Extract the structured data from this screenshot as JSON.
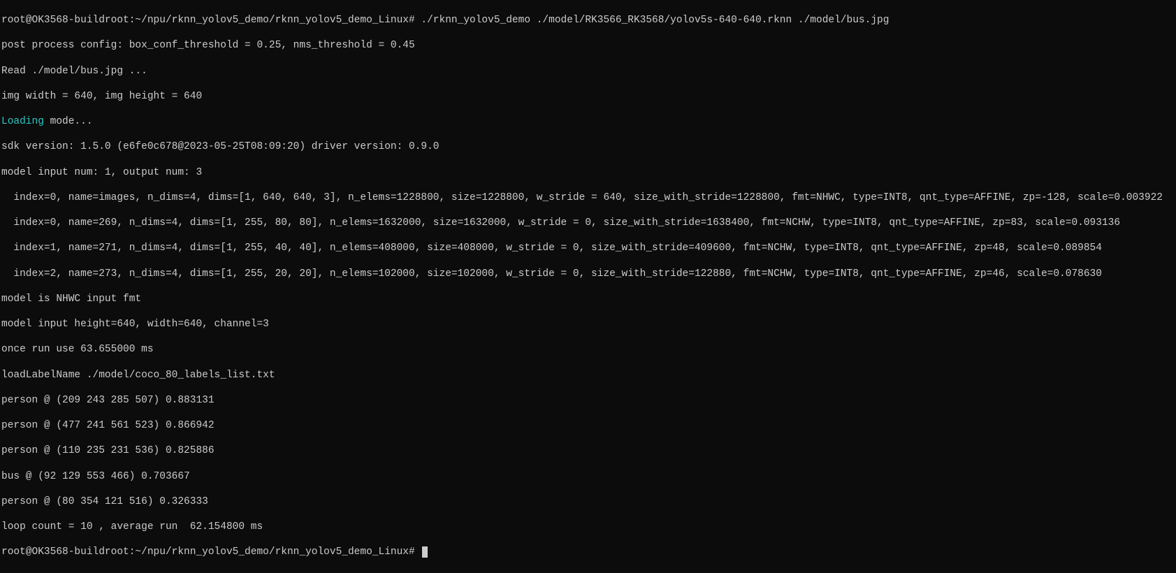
{
  "prompt": "root@OK3568-buildroot:~/npu/rknn_yolov5_demo/rknn_yolov5_demo_Linux#",
  "command": "./rknn_yolov5_demo ./model/RK3566_RK3568/yolov5s-640-640.rknn ./model/bus.jpg",
  "postprocess": "post process config: box_conf_threshold = 0.25, nms_threshold = 0.45",
  "read": "Read ./model/bus.jpg ...",
  "imgsize": "img width = 640, img height = 640",
  "loading_word": "Loading",
  "loading_rest": " mode...",
  "sdk": "sdk version: 1.5.0 (e6fe0c678@2023-05-25T08:09:20) driver version: 0.9.0",
  "io_num": "model input num: 1, output num: 3",
  "tensor0": "  index=0, name=images, n_dims=4, dims=[1, 640, 640, 3], n_elems=1228800, size=1228800, w_stride = 640, size_with_stride=1228800, fmt=NHWC, type=INT8, qnt_type=AFFINE, zp=-128, scale=0.003922",
  "tensor1": "  index=0, name=269, n_dims=4, dims=[1, 255, 80, 80], n_elems=1632000, size=1632000, w_stride = 0, size_with_stride=1638400, fmt=NCHW, type=INT8, qnt_type=AFFINE, zp=83, scale=0.093136",
  "tensor2": "  index=1, name=271, n_dims=4, dims=[1, 255, 40, 40], n_elems=408000, size=408000, w_stride = 0, size_with_stride=409600, fmt=NCHW, type=INT8, qnt_type=AFFINE, zp=48, scale=0.089854",
  "tensor3": "  index=2, name=273, n_dims=4, dims=[1, 255, 20, 20], n_elems=102000, size=102000, w_stride = 0, size_with_stride=122880, fmt=NCHW, type=INT8, qnt_type=AFFINE, zp=46, scale=0.078630",
  "fmt": "model is NHWC input fmt",
  "dims_line": "model input height=640, width=640, channel=3",
  "once": "once run use 63.655000 ms",
  "labels": "loadLabelName ./model/coco_80_labels_list.txt",
  "det0": "person @ (209 243 285 507) 0.883131",
  "det1": "person @ (477 241 561 523) 0.866942",
  "det2": "person @ (110 235 231 536) 0.825886",
  "det3": "bus @ (92 129 553 466) 0.703667",
  "det4": "person @ (80 354 121 516) 0.326333",
  "loop": "loop count = 10 , average run  62.154800 ms",
  "prompt2": "root@OK3568-buildroot:~/npu/rknn_yolov5_demo/rknn_yolov5_demo_Linux# "
}
